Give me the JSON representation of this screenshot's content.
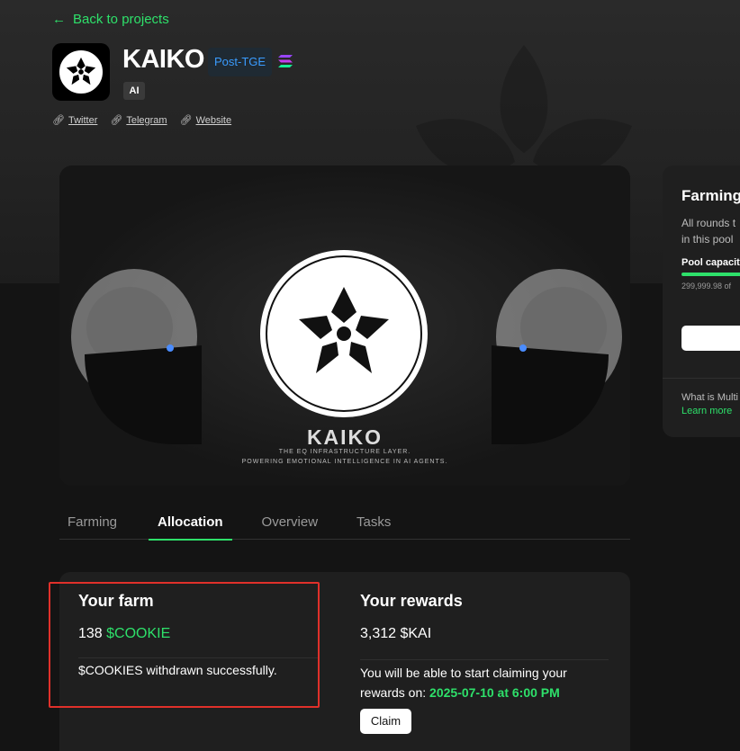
{
  "nav": {
    "back_label": "Back to projects"
  },
  "project": {
    "name": "KAIKO",
    "status_badge": "Post-TGE",
    "chain_icon": "solana-icon",
    "category_tag": "AI",
    "links": [
      {
        "label": "Twitter",
        "icon": "link-icon"
      },
      {
        "label": "Telegram",
        "icon": "link-icon"
      },
      {
        "label": "Website",
        "icon": "link-icon"
      }
    ]
  },
  "banner": {
    "brand": "KAIKO",
    "tagline_1": "THE EQ INFRASTRUCTURE LAYER.",
    "tagline_2": "POWERING EMOTIONAL INTELLIGENCE IN AI AGENTS."
  },
  "tabs": [
    {
      "label": "Farming",
      "active": false
    },
    {
      "label": "Allocation",
      "active": true
    },
    {
      "label": "Overview",
      "active": false
    },
    {
      "label": "Tasks",
      "active": false
    }
  ],
  "farm": {
    "title": "Your farm",
    "amount": "138",
    "token": "$COOKIE",
    "message": "$COOKIES withdrawn successfully."
  },
  "rewards": {
    "title": "Your rewards",
    "amount": "3,312 $KAI",
    "message": "You will be able to start claiming your rewards on:",
    "date": "2025-07-10 at 6:00 PM",
    "claim_label": "Claim"
  },
  "side_panel": {
    "title": "Farming",
    "desc_1": "All rounds t",
    "desc_2": "in this pool",
    "capacity_label": "Pool capacit",
    "capacity_value": "299,999.98 of",
    "faq": "What is Multi",
    "learn_more": "Learn more"
  },
  "colors": {
    "accent": "#2ee06a",
    "badge_blue": "#3a9cff",
    "highlight": "#e0302a"
  }
}
